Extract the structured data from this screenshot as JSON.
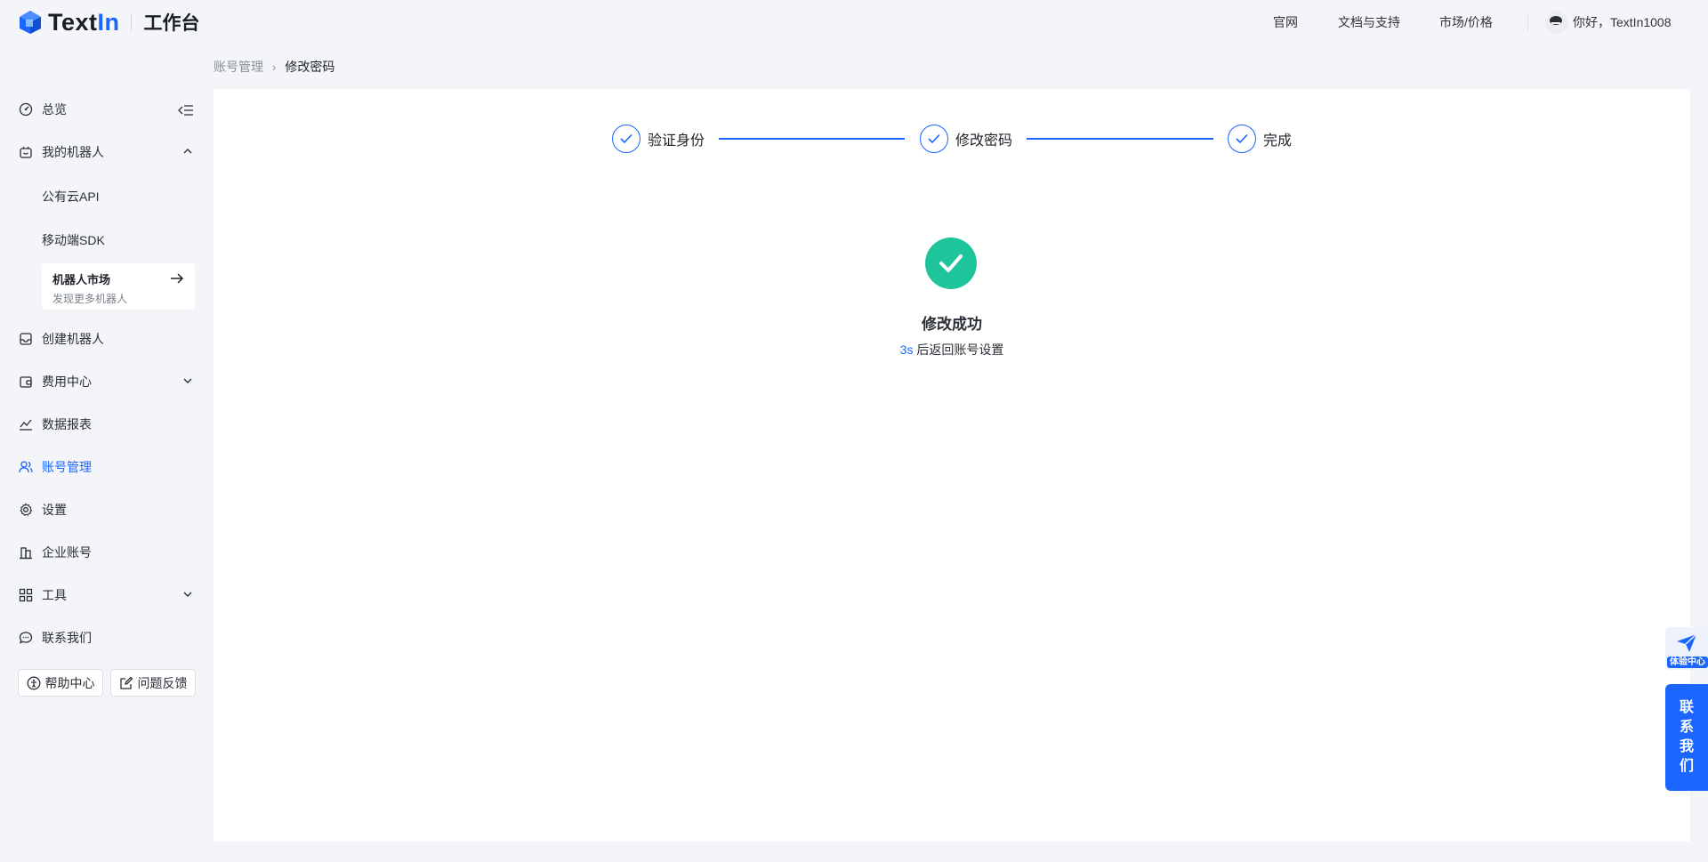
{
  "header": {
    "logo_text_a": "Text",
    "logo_text_b": "In",
    "logo_sub": "工作台",
    "nav": [
      "官网",
      "文档与支持",
      "市场/价格"
    ],
    "user_greeting": "你好，TextIn1008"
  },
  "sidebar": {
    "overview": "总览",
    "my_robots": "我的机器人",
    "public_api": "公有云API",
    "mobile_sdk": "移动端SDK",
    "market_title": "机器人市场",
    "market_sub": "发现更多机器人",
    "create_robot": "创建机器人",
    "billing": "费用中心",
    "reports": "数据报表",
    "account": "账号管理",
    "settings": "设置",
    "enterprise": "企业账号",
    "tools": "工具",
    "contact": "联系我们",
    "help": "帮助中心",
    "feedback": "问题反馈"
  },
  "breadcrumb": {
    "parent": "账号管理",
    "sep": "›",
    "current": "修改密码"
  },
  "steps": [
    "验证身份",
    "修改密码",
    "完成"
  ],
  "result": {
    "title": "修改成功",
    "countdown": "3s",
    "suffix": " 后返回账号设置"
  },
  "float": {
    "experience": "体验中心",
    "contact_chars": [
      "联",
      "系",
      "我",
      "们"
    ]
  },
  "colors": {
    "accent": "#1a66ff",
    "success": "#1ec59a"
  }
}
